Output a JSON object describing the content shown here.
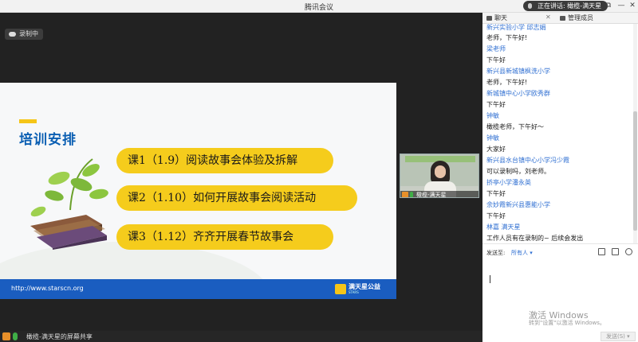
{
  "window": {
    "title": "腾讯会议",
    "speaking": "正在讲话: 橄榄-满天星"
  },
  "recording": {
    "label": "录制中"
  },
  "slide": {
    "title": "培训安排",
    "courses": [
      "课1（1.9）阅读故事会体验及拆解",
      "课2（1.10）如何开展故事会阅读活动",
      "课3（1.12）齐齐开展春节故事会"
    ],
    "url": "http://www.starscn.org",
    "logo_text": "满天星公益",
    "logo_sub": "STARS"
  },
  "video": {
    "name": "橄榄-满天星"
  },
  "share_bar": {
    "label": "橄榄-满天星的屏幕共享"
  },
  "panel": {
    "tab_chat": "聊天",
    "tab_close": "✕",
    "tab_members": "管理成员",
    "messages": [
      {
        "kind": "sender",
        "text": "新兴实验小学 邱志娟"
      },
      {
        "kind": "msg",
        "text": "老师，下午好!"
      },
      {
        "kind": "sender",
        "text": "梁老师"
      },
      {
        "kind": "msg",
        "text": "下午好"
      },
      {
        "kind": "sender",
        "text": "新兴县新城镇枫洗小学"
      },
      {
        "kind": "msg",
        "text": "老师，下午好!"
      },
      {
        "kind": "sender",
        "text": "新城镇中心小学欧秀群"
      },
      {
        "kind": "msg",
        "text": "下午好"
      },
      {
        "kind": "sender",
        "text": "钟敏"
      },
      {
        "kind": "msg",
        "text": "橄榄老师，下午好～"
      },
      {
        "kind": "sender",
        "text": "钟敏"
      },
      {
        "kind": "msg",
        "text": "大家好"
      },
      {
        "kind": "sender",
        "text": "新兴县水台镇中心小学冯少霞"
      },
      {
        "kind": "msg",
        "text": "可以录制吗，刘老师。"
      },
      {
        "kind": "sender",
        "text": "挢亭小学潘永英"
      },
      {
        "kind": "msg",
        "text": "下午好"
      },
      {
        "kind": "sender",
        "text": "余妙霞新兴县惠能小学"
      },
      {
        "kind": "msg",
        "text": "下午好"
      },
      {
        "kind": "sender",
        "text": "林嘉 满天星"
      },
      {
        "kind": "msg",
        "text": "工作人员有在录制的~ 后续会发出"
      }
    ],
    "send_to_label": "发送至:",
    "send_to_value": "所有人 ▾",
    "send_button": "发送(S) ▾",
    "watermark_title": "激活 Windows",
    "watermark_sub": "转到\"设置\"以激活 Windows。"
  },
  "colors": {
    "accent_yellow": "#f5cc1c",
    "title_blue": "#0b5fb3",
    "footer_blue": "#1a5dc0",
    "link_blue": "#2f6fd2"
  }
}
